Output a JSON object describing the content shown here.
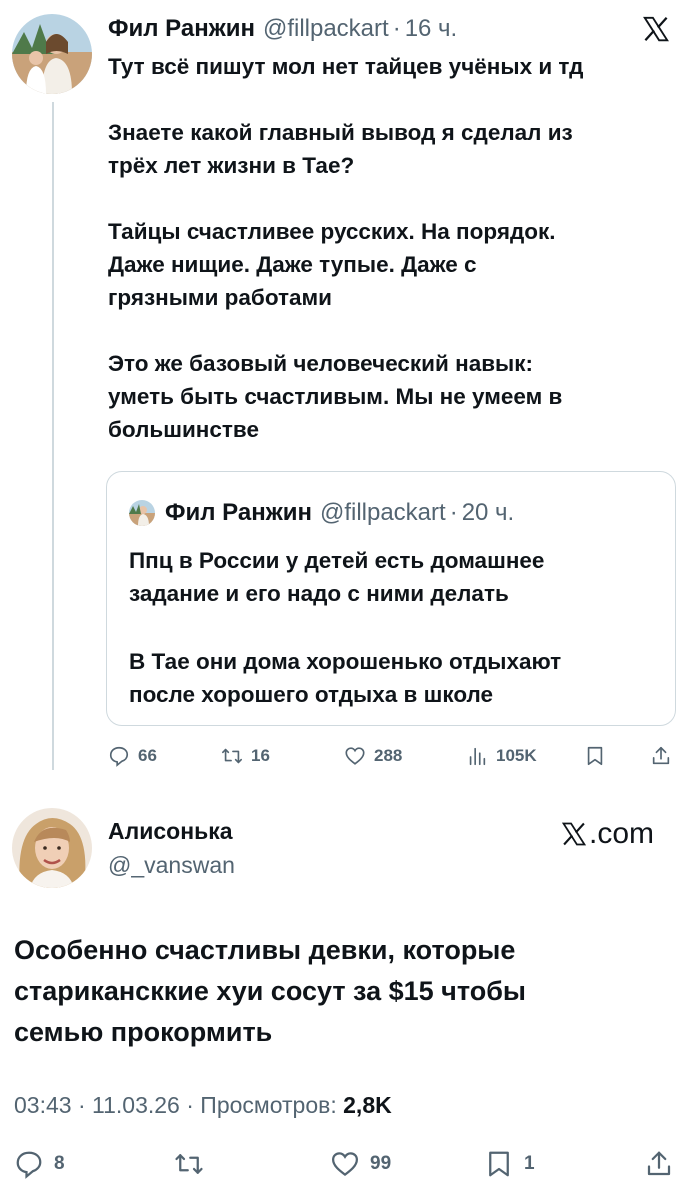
{
  "tweet": {
    "author_name": "Фил Ранжин",
    "author_handle": "@fillpackart",
    "separator": "·",
    "time": "16 ч.",
    "lines": [
      "Тут всё пишут мол нет тайцев учёных и тд",
      "",
      "Знаете какой главный вывод я сделал из",
      "трёх лет жизни в Тае?",
      "",
      "Тайцы счастливее русских. На порядок.",
      "Даже нищие. Даже тупые. Даже с",
      "грязными работами",
      "",
      "Это же базовый человеческий навык:",
      "уметь быть счастливым. Мы не умеем в",
      "большинстве"
    ],
    "quote": {
      "author_name": "Фил Ранжин",
      "author_handle": "@fillpackart",
      "time": "20 ч.",
      "lines": [
        "Ппц в России у детей есть домашнее",
        "задание и его надо с ними делать",
        "",
        "В Тае они дома хорошенько отдыхают",
        "после хорошего отдыха в школе"
      ]
    },
    "stats": {
      "replies": "66",
      "reposts": "16",
      "likes": "288",
      "views": "105K"
    }
  },
  "reply": {
    "author_name": "Алисонька",
    "author_handle": "@_vanswan",
    "brand": ".com",
    "lines": [
      "Особенно счастливы девки, которые",
      "старикансккие хуи сосут за $15 чтобы",
      "семью прокормить"
    ],
    "meta_time": "03:43",
    "meta_date": "11.03.26",
    "meta_views_label": "Просмотров:",
    "meta_views": "2,8K",
    "separator": "·",
    "stats": {
      "replies": "8",
      "likes": "99",
      "bookmarks": "1"
    }
  },
  "colors": {
    "text": "#0f1419",
    "secondary": "#536471",
    "border": "#cfd9de"
  },
  "icons": [
    "x-logo-icon",
    "reply-icon",
    "repost-icon",
    "like-icon",
    "views-icon",
    "bookmark-icon",
    "share-icon"
  ]
}
